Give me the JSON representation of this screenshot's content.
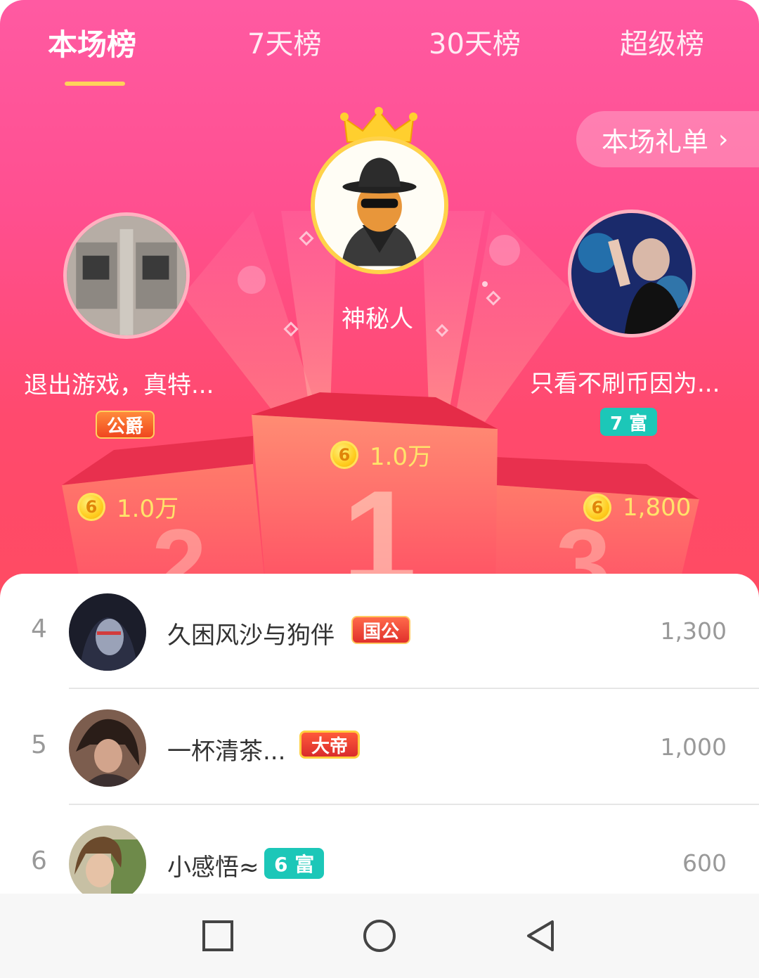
{
  "tabs": [
    "本场榜",
    "7天榜",
    "30天榜",
    "超级榜"
  ],
  "active_tab": 0,
  "gift_list_label": "本场礼单",
  "podium": {
    "first": {
      "name": "神秘人",
      "coins": "1.0万"
    },
    "second": {
      "name": "退出游戏，真特...",
      "coins": "1.0万",
      "badge": "公爵"
    },
    "third": {
      "name": "只看不刷币因为...",
      "coins": "1,800",
      "badge": "7 富"
    }
  },
  "coin_symbol": "6",
  "list": [
    {
      "rank": "4",
      "name": "久困风沙与狗伴",
      "badge": "国公",
      "value": "1,300"
    },
    {
      "rank": "5",
      "name": "一杯清茶...",
      "badge": "大帝",
      "value": "1,000"
    },
    {
      "rank": "6",
      "name": "小感悟≈",
      "badge": "6 富",
      "value": "600"
    }
  ],
  "colors": {
    "accent": "#ff4f8f",
    "underline": "#ffd25a",
    "coin_text": "#ffe36a",
    "rich_badge": "#1cc7b8"
  }
}
